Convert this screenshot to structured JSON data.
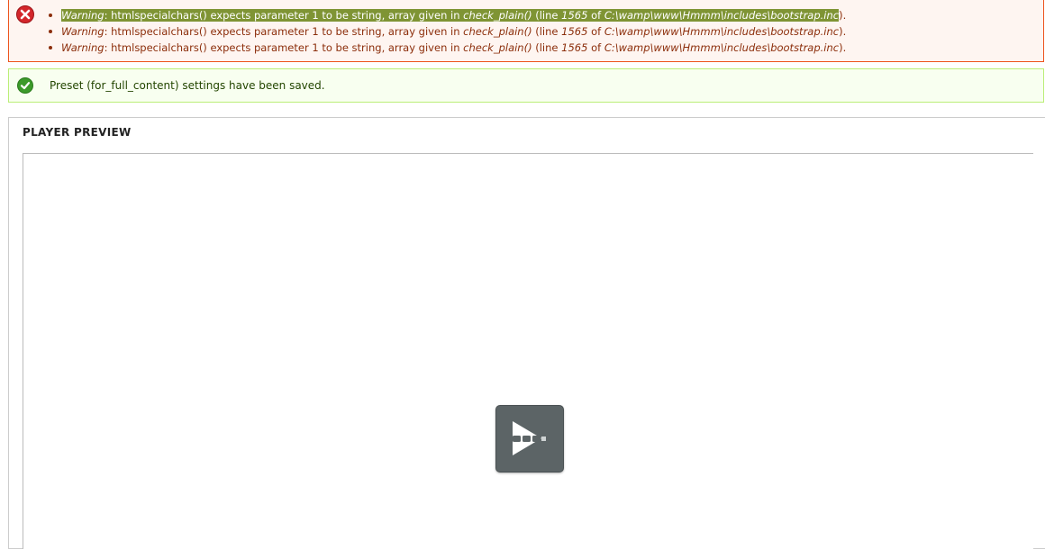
{
  "messages": {
    "errors": [
      {
        "label": "Warning",
        "text_a": ": htmlspecialchars() expects parameter 1 to be string, array given in ",
        "func": "check_plain()",
        "text_b": " (line ",
        "line": "1565",
        "text_c": " of ",
        "path": "C:\\wamp\\www\\Hmmm\\includes\\bootstrap.inc",
        "text_d": ")."
      },
      {
        "label": "Warning",
        "text_a": ": htmlspecialchars() expects parameter 1 to be string, array given in ",
        "func": "check_plain()",
        "text_b": " (line ",
        "line": "1565",
        "text_c": " of ",
        "path": "C:\\wamp\\www\\Hmmm\\includes\\bootstrap.inc",
        "text_d": ")."
      },
      {
        "label": "Warning",
        "text_a": ": htmlspecialchars() expects parameter 1 to be string, array given in ",
        "func": "check_plain()",
        "text_b": " (line ",
        "line": "1565",
        "text_c": " of ",
        "path": "C:\\wamp\\www\\Hmmm\\includes\\bootstrap.inc",
        "text_d": ")."
      }
    ],
    "status": "Preset (for_full_content) settings have been saved."
  },
  "player_preview": {
    "legend": "PLAYER PREVIEW",
    "play_icon": "play-icon"
  },
  "colors": {
    "error_bg": "#fef5f1",
    "error_border": "#ed541d",
    "error_text": "#8c2e0b",
    "selection": "#7f9434",
    "status_bg": "#f8fff0",
    "status_border": "#bbee77",
    "play_button": "#5c6466"
  },
  "icons": {
    "error": "error-x-icon",
    "status": "check-icon"
  }
}
